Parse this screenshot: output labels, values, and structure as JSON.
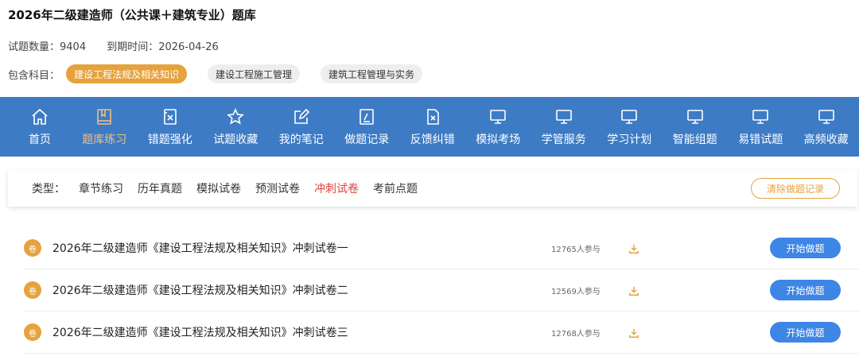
{
  "title": "2026年二级建造师（公共课＋建筑专业）题库",
  "meta": {
    "question_count": "试题数量：9404",
    "expiry": "到期时间：2026-04-26"
  },
  "subjects": {
    "label": "包含科目：",
    "items": [
      {
        "label": "建设工程法规及相关知识",
        "active": true
      },
      {
        "label": "建设工程施工管理",
        "active": false
      },
      {
        "label": "建筑工程管理与实务",
        "active": false
      }
    ]
  },
  "nav": {
    "items": [
      {
        "label": "首页",
        "icon": "home-icon",
        "active": false
      },
      {
        "label": "题库练习",
        "icon": "book-icon",
        "active": true
      },
      {
        "label": "错题强化",
        "icon": "wrong-doc-icon",
        "active": false
      },
      {
        "label": "试题收藏",
        "icon": "star-icon",
        "active": false
      },
      {
        "label": "我的笔记",
        "icon": "note-edit-icon",
        "active": false
      },
      {
        "label": "做题记录",
        "icon": "record-icon",
        "active": false
      },
      {
        "label": "反馈纠错",
        "icon": "feedback-icon",
        "active": false
      },
      {
        "label": "模拟考场",
        "icon": "monitor-icon",
        "active": false
      },
      {
        "label": "学管服务",
        "icon": "monitor-icon",
        "active": false
      },
      {
        "label": "学习计划",
        "icon": "monitor-icon",
        "active": false
      },
      {
        "label": "智能组题",
        "icon": "monitor-icon",
        "active": false
      },
      {
        "label": "易错试题",
        "icon": "monitor-icon",
        "active": false
      },
      {
        "label": "高频收藏",
        "icon": "monitor-icon",
        "active": false
      }
    ]
  },
  "filter": {
    "type_label": "类型：",
    "options": [
      {
        "label": "章节练习",
        "active": false
      },
      {
        "label": "历年真题",
        "active": false
      },
      {
        "label": "模拟试卷",
        "active": false
      },
      {
        "label": "预测试卷",
        "active": false
      },
      {
        "label": "冲刺试卷",
        "active": true
      },
      {
        "label": "考前点题",
        "active": false
      }
    ],
    "clear_label": "清除做题记录"
  },
  "papers": [
    {
      "badge": "卷",
      "title": "2026年二级建造师《建设工程法规及相关知识》冲刺试卷一",
      "count": "12765人参与",
      "button": "开始做题"
    },
    {
      "badge": "卷",
      "title": "2026年二级建造师《建设工程法规及相关知识》冲刺试卷二",
      "count": "12569人参与",
      "button": "开始做题"
    },
    {
      "badge": "卷",
      "title": "2026年二级建造师《建设工程法规及相关知识》冲刺试卷三",
      "count": "12768人参与",
      "button": "开始做题"
    }
  ],
  "colors": {
    "nav_bg": "#3d7bc5",
    "accent_orange": "#e6a23c",
    "active_red": "#e0413a",
    "button_blue": "#3d86e6"
  }
}
